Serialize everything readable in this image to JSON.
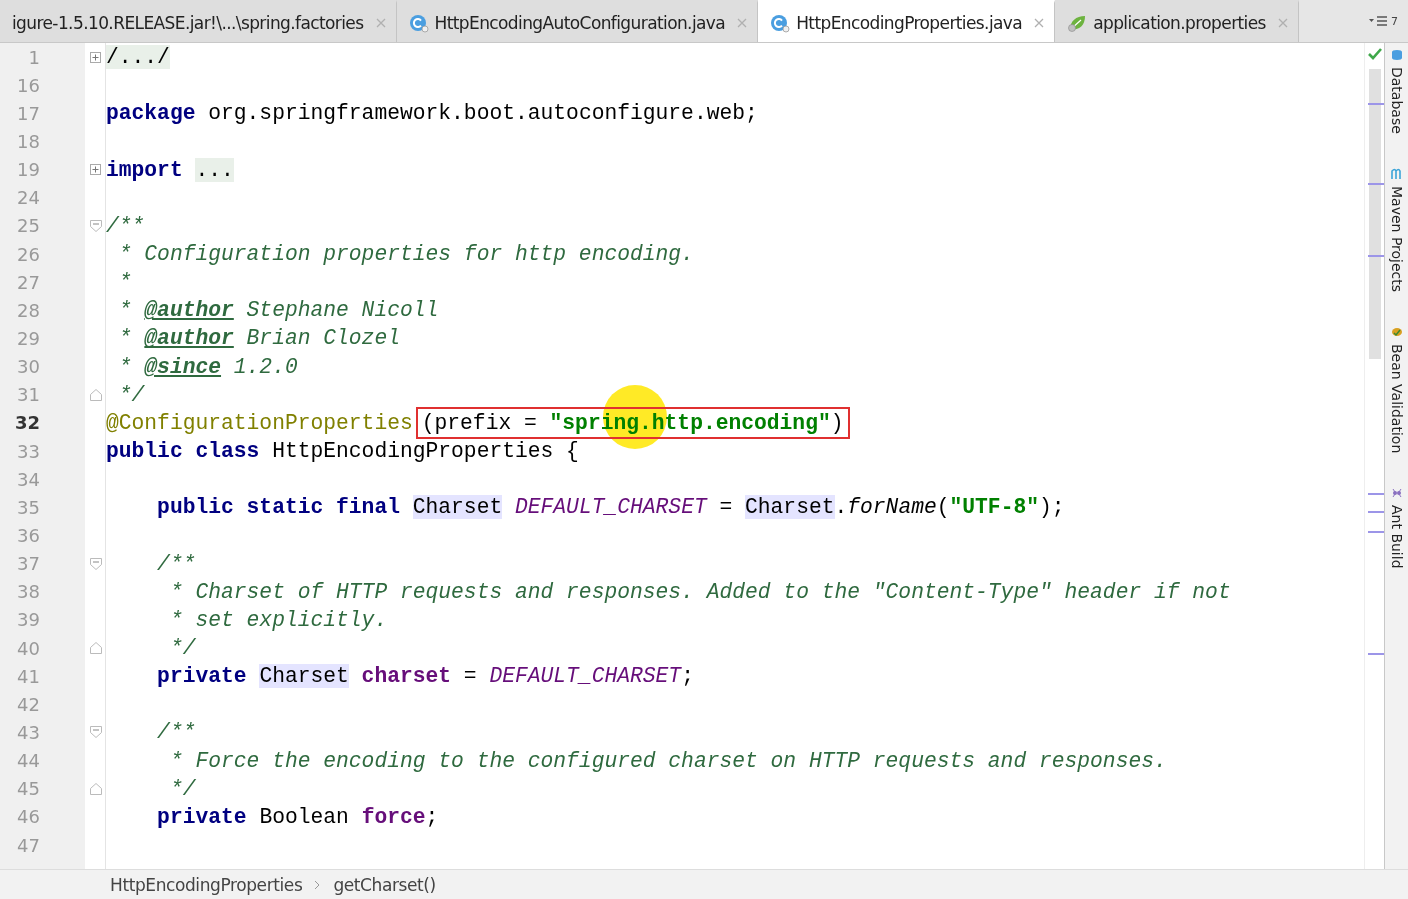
{
  "tabs": [
    {
      "label": "igure-1.5.10.RELEASE.jar!\\...\\spring.factories",
      "selected": false
    },
    {
      "label": "HttpEncodingAutoConfiguration.java",
      "kind": "class",
      "selected": false
    },
    {
      "label": "HttpEncodingProperties.java",
      "kind": "class",
      "selected": true
    },
    {
      "label": "application.properties",
      "kind": "properties",
      "selected": false
    }
  ],
  "tab_overflow": {
    "count": "7"
  },
  "editor": {
    "lines": [
      {
        "number": "1",
        "kind": "fold-expand",
        "current": false,
        "tokens": [
          {
            "kind": "folded",
            "text": "/.../"
          }
        ]
      },
      {
        "number": "16",
        "current": false
      },
      {
        "number": "17",
        "current": false,
        "tokens": [
          {
            "kind": "keyword",
            "text": "package "
          },
          {
            "kind": "plain",
            "text": "org.springframework.boot.autoconfigure.web;"
          }
        ]
      },
      {
        "number": "18",
        "current": false
      },
      {
        "number": "19",
        "kind": "fold-expand",
        "current": false,
        "tokens": [
          {
            "kind": "keyword",
            "text": "import "
          },
          {
            "kind": "folded",
            "text": "..."
          }
        ]
      },
      {
        "number": "24",
        "current": false
      },
      {
        "number": "25",
        "kind": "fold-start",
        "current": false,
        "tokens": [
          {
            "kind": "comment",
            "text": "/**"
          }
        ]
      },
      {
        "number": "26",
        "current": false,
        "tokens": [
          {
            "kind": "comment",
            "text": " * Configuration properties for http encoding."
          }
        ]
      },
      {
        "number": "27",
        "current": false,
        "tokens": [
          {
            "kind": "comment",
            "text": " *"
          }
        ]
      },
      {
        "number": "28",
        "current": false,
        "tokens": [
          {
            "kind": "comment",
            "text": " * "
          },
          {
            "kind": "doc-tag",
            "text": "@author"
          },
          {
            "kind": "comment",
            "text": " Stephane Nicoll"
          }
        ]
      },
      {
        "number": "29",
        "current": false,
        "tokens": [
          {
            "kind": "comment",
            "text": " * "
          },
          {
            "kind": "doc-tag",
            "text": "@author"
          },
          {
            "kind": "comment",
            "text": " Brian Clozel"
          }
        ]
      },
      {
        "number": "30",
        "current": false,
        "tokens": [
          {
            "kind": "comment",
            "text": " * "
          },
          {
            "kind": "doc-tag",
            "text": "@since"
          },
          {
            "kind": "comment",
            "text": " 1.2.0"
          }
        ]
      },
      {
        "number": "31",
        "kind": "fold-end",
        "current": false,
        "tokens": [
          {
            "kind": "comment",
            "text": " */"
          }
        ]
      },
      {
        "number": "32",
        "current": true,
        "tokens": [
          {
            "kind": "annotation",
            "text": "@ConfigurationProperties",
            "boxed": false
          },
          {
            "kind": "plain",
            "text": "(prefix = ",
            "boxed": true
          },
          {
            "kind": "string",
            "text": "\"spring.http.encoding\"",
            "boxed": true
          },
          {
            "kind": "plain",
            "text": ")",
            "boxed": true
          }
        ]
      },
      {
        "number": "33",
        "current": false,
        "tokens": [
          {
            "kind": "keyword",
            "text": "public class "
          },
          {
            "kind": "plain",
            "text": "HttpEncodingProperties {"
          }
        ]
      },
      {
        "number": "34",
        "current": false
      },
      {
        "number": "35",
        "current": false,
        "tokens": [
          {
            "kind": "keyword",
            "text": "    public static final "
          },
          {
            "kind": "type-usage",
            "text": "Charset"
          },
          {
            "kind": "constant",
            "text": " DEFAULT_CHARSET"
          },
          {
            "kind": "plain",
            "text": " = "
          },
          {
            "kind": "type-usage",
            "text": "Charset"
          },
          {
            "kind": "plain",
            "text": "."
          },
          {
            "kind": "static-method",
            "text": "forName"
          },
          {
            "kind": "plain",
            "text": "("
          },
          {
            "kind": "string",
            "text": "\"UTF-8\""
          },
          {
            "kind": "plain",
            "text": ");"
          }
        ]
      },
      {
        "number": "36",
        "current": false
      },
      {
        "number": "37",
        "kind": "fold-start",
        "current": false,
        "tokens": [
          {
            "kind": "comment",
            "text": "    /**"
          }
        ]
      },
      {
        "number": "38",
        "current": false,
        "tokens": [
          {
            "kind": "comment",
            "text": "     * Charset of HTTP requests and responses. Added to the \"Content-Type\" header if not"
          }
        ]
      },
      {
        "number": "39",
        "current": false,
        "tokens": [
          {
            "kind": "comment",
            "text": "     * set explicitly."
          }
        ]
      },
      {
        "number": "40",
        "kind": "fold-end",
        "current": false,
        "tokens": [
          {
            "kind": "comment",
            "text": "     */"
          }
        ]
      },
      {
        "number": "41",
        "current": false,
        "tokens": [
          {
            "kind": "keyword",
            "text": "    private "
          },
          {
            "kind": "type-usage",
            "text": "Charset"
          },
          {
            "kind": "field",
            "text": " charset"
          },
          {
            "kind": "plain",
            "text": " = "
          },
          {
            "kind": "constant",
            "text": "DEFAULT_CHARSET"
          },
          {
            "kind": "plain",
            "text": ";"
          }
        ]
      },
      {
        "number": "42",
        "current": false
      },
      {
        "number": "43",
        "kind": "fold-start",
        "current": false,
        "tokens": [
          {
            "kind": "comment",
            "text": "    /**"
          }
        ]
      },
      {
        "number": "44",
        "current": false,
        "tokens": [
          {
            "kind": "comment",
            "text": "     * Force the encoding to the configured charset on HTTP requests and responses."
          }
        ]
      },
      {
        "number": "45",
        "kind": "fold-end",
        "current": false,
        "tokens": [
          {
            "kind": "comment",
            "text": "     */"
          }
        ]
      },
      {
        "number": "46",
        "current": false,
        "tokens": [
          {
            "kind": "keyword",
            "text": "    private "
          },
          {
            "kind": "plain",
            "text": "Boolean "
          },
          {
            "kind": "field",
            "text": "force"
          },
          {
            "kind": "plain",
            "text": ";"
          }
        ]
      },
      {
        "number": "47",
        "current": false
      }
    ]
  },
  "tool_windows": [
    {
      "label": "Database",
      "kind": "database"
    },
    {
      "label": "Maven Projects",
      "kind": "maven"
    },
    {
      "label": "Bean Validation",
      "kind": "bean"
    },
    {
      "label": "Ant Build",
      "kind": "ant"
    }
  ],
  "breadcrumbs": [
    "HttpEncodingProperties",
    "getCharset()"
  ]
}
